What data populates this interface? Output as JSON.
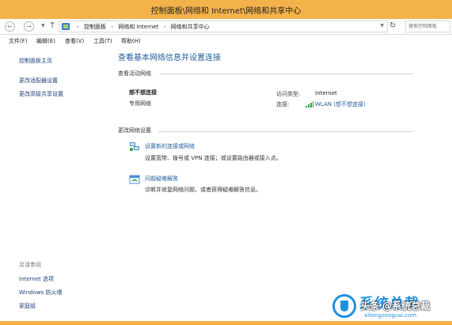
{
  "window": {
    "title": "控制面板\\网络和 Internet\\网络和共享中心"
  },
  "address": {
    "crumbs": [
      "控制面板",
      "网络和 Internet",
      "网络和共享中心"
    ],
    "search_placeholder": "搜索控制面板"
  },
  "menu": {
    "items": [
      "文件(F)",
      "编辑(E)",
      "查看(V)",
      "工具(T)",
      "帮助(H)"
    ]
  },
  "sidebar": {
    "links": [
      "控制面板主页",
      "更改适配器设置",
      "更改高级共享设置"
    ],
    "see_also_heading": "另请参阅",
    "see_also": [
      "Internet 选项",
      "Windows 防火墙",
      "家庭组"
    ]
  },
  "main": {
    "title": "查看基本网络信息并设置连接",
    "active_networks_label": "查看活动网络",
    "network": {
      "name": "想不想连接",
      "category": "专用网络",
      "access_type_label": "访问类型:",
      "access_type_value": "Internet",
      "connections_label": "连接:",
      "connection_value": "WLAN (想不想连接)"
    },
    "change_settings_label": "更改网络设置",
    "tasks": [
      {
        "link": "设置新的连接或网络",
        "desc": "设置宽带、拨号或 VPN 连接；或设置路由器或接入点。",
        "icon": "network-setup-icon"
      },
      {
        "link": "问题疑难解答",
        "desc": "诊断并修复网络问题，或者获得疑难解答信息。",
        "icon": "troubleshoot-icon"
      }
    ]
  },
  "watermark": {
    "brand": "系统总裁",
    "site": "xitongzongcai.com",
    "overlay": "头条 @系统总裁"
  },
  "colors": {
    "titlebar": "#f4b24a",
    "link": "#1f5c9a",
    "watermark": "#1f8fe0"
  }
}
